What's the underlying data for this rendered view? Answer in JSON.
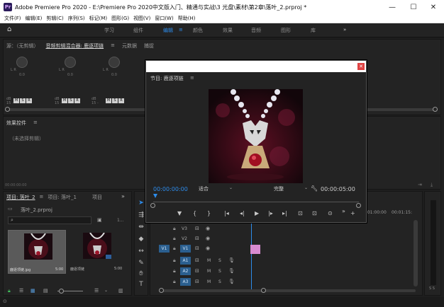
{
  "titlebar": {
    "logo": "Pr",
    "title": "Adobe Premiere Pro 2020 - E:\\Premiere Pro 2020中文版入门、精通与实战\\3 光盘\\素材\\第2章\\落叶_2.prproj *",
    "min": "—",
    "max": "☐",
    "close": "✕"
  },
  "menu": [
    "文件(F)",
    "编辑(E)",
    "剪辑(C)",
    "序列(S)",
    "标记(M)",
    "图形(G)",
    "视图(V)",
    "窗口(W)",
    "帮助(H)"
  ],
  "workspaces": {
    "items": [
      "学习",
      "组件",
      "编辑",
      "颜色",
      "效果",
      "音频",
      "图形",
      "库"
    ],
    "active_index": 2,
    "active_menu": "≡",
    "more": "»"
  },
  "audio_mixer": {
    "tabs": [
      "源：（无剪辑）",
      "音频剪辑混合器: 鹿逐项链",
      "≡",
      "元数据",
      "捕捉"
    ],
    "channels": [
      {
        "lr": "L  \u0000  R",
        "val": "0.0"
      },
      {
        "lr": "L  \u0000  R",
        "val": "0.0"
      },
      {
        "lr": "L  \u0000  R",
        "val": "0.0"
      },
      {
        "lr": "L  \u0000  R",
        "val": "0.0"
      }
    ],
    "lr_label": "L     R",
    "value": "0.0",
    "db": "dB",
    "db2": "15 -"
  },
  "effect_controls": {
    "title": "效果控件",
    "menu": "≡",
    "empty": "（未选择剪辑）",
    "time": "00:00:00:00"
  },
  "program": {
    "title": "节目: 鹿逐项链",
    "menu": "≡",
    "timecode": "00:00:00:00",
    "fit": "适合",
    "quality": "完整",
    "duration": "00:00:05:00",
    "controls": [
      "▼",
      "{",
      "}",
      "|◂",
      "◂|",
      "▶",
      "|▸",
      "▸|",
      "⊡",
      "⊡",
      "⊙",
      "»",
      "+"
    ]
  },
  "project": {
    "tabs": [
      "项目: 落叶_2",
      "≡",
      "项目: 落叶_1",
      "项目"
    ],
    "more": "»",
    "file": "落叶_2.prproj",
    "search_placeholder": "",
    "count": "1...",
    "items": [
      {
        "name": "鹿逐项链.jpg",
        "dur": "5:00"
      },
      {
        "name": "鹿逐项链",
        "dur": "5:00"
      }
    ]
  },
  "timeline": {
    "timecodes": [
      "1:01:00:00",
      "00:01:15:"
    ],
    "tracks": [
      {
        "label": "V3",
        "type": "video"
      },
      {
        "label": "V2",
        "type": "video"
      },
      {
        "label": "V1",
        "type": "video",
        "src": "V1"
      },
      {
        "label": "A1",
        "type": "audio",
        "m": "M",
        "s": "S"
      },
      {
        "label": "A2",
        "type": "audio",
        "m": "M",
        "s": "S"
      },
      {
        "label": "A3",
        "type": "audio",
        "m": "M",
        "s": "S"
      }
    ]
  },
  "meter": {
    "label": "S S"
  },
  "statusbar": {
    "icon": "⊙"
  },
  "colors": {
    "accent": "#2d8ceb",
    "clip": "#d88bd0",
    "close": "#e04343"
  }
}
